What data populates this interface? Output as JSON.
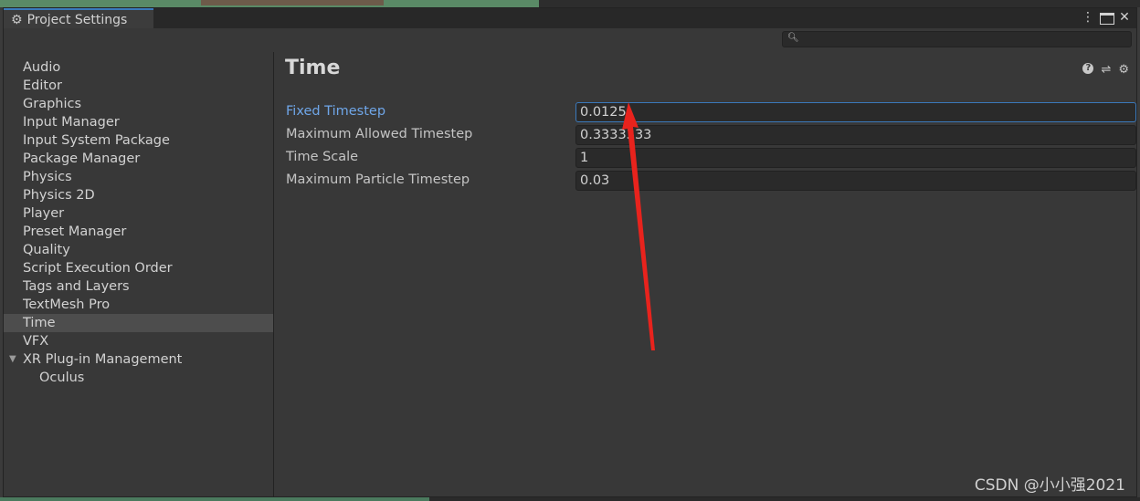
{
  "window": {
    "tab_title": "Project Settings",
    "tab_icon": "gear-icon",
    "controls": [
      "more-icon",
      "maximize-icon",
      "close-icon"
    ],
    "close_glyph": "✕",
    "more_glyph": "⋮"
  },
  "search": {
    "placeholder": "",
    "icon": "search-icon"
  },
  "sidebar": {
    "items": [
      {
        "label": "Audio"
      },
      {
        "label": "Editor"
      },
      {
        "label": "Graphics"
      },
      {
        "label": "Input Manager"
      },
      {
        "label": "Input System Package"
      },
      {
        "label": "Package Manager"
      },
      {
        "label": "Physics"
      },
      {
        "label": "Physics 2D"
      },
      {
        "label": "Player"
      },
      {
        "label": "Preset Manager"
      },
      {
        "label": "Quality"
      },
      {
        "label": "Script Execution Order"
      },
      {
        "label": "Tags and Layers"
      },
      {
        "label": "TextMesh Pro"
      },
      {
        "label": "Time"
      },
      {
        "label": "VFX"
      },
      {
        "label": "XR Plug-in Management"
      },
      {
        "label": "Oculus"
      }
    ],
    "selected": "Time"
  },
  "main": {
    "title": "Time",
    "header_icons": [
      "help-icon",
      "preset-icon",
      "settings-icon"
    ],
    "fields": [
      {
        "label": "Fixed Timestep",
        "value": "0.0125"
      },
      {
        "label": "Maximum Allowed Timestep",
        "value": "0.3333333"
      },
      {
        "label": "Time Scale",
        "value": "1"
      },
      {
        "label": "Maximum Particle Timestep",
        "value": "0.03"
      }
    ]
  },
  "annotation": {
    "color": "#e8231d"
  },
  "watermark": "CSDN @小小强2021"
}
